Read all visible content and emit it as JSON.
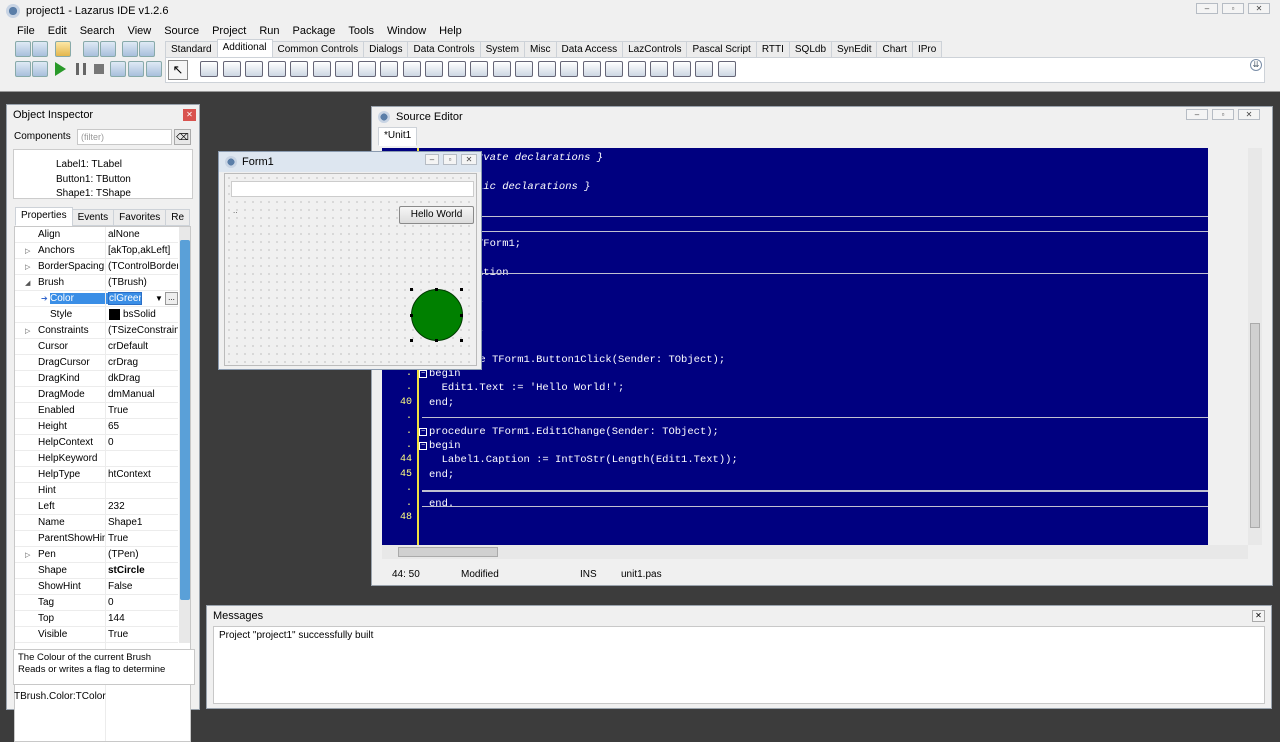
{
  "main": {
    "title": "project1 - Lazarus IDE v1.2.6",
    "menu": [
      "File",
      "Edit",
      "Search",
      "View",
      "Source",
      "Project",
      "Run",
      "Package",
      "Tools",
      "Window",
      "Help"
    ],
    "palette_tabs": [
      "Standard",
      "Additional",
      "Common Controls",
      "Dialogs",
      "Data Controls",
      "System",
      "Misc",
      "Data Access",
      "LazControls",
      "Pascal Script",
      "RTTI",
      "SQLdb",
      "SynEdit",
      "Chart",
      "IPro"
    ],
    "active_tab": "Additional"
  },
  "inspector": {
    "title": "Object Inspector",
    "components_label": "Components",
    "filter_placeholder": "(filter)",
    "tree": [
      "Label1: TLabel",
      "Button1: TButton",
      "Shape1: TShape"
    ],
    "tabs": [
      "Properties",
      "Events",
      "Favorites",
      "Re"
    ],
    "props": [
      {
        "n": "Align",
        "v": "alNone",
        "e": ""
      },
      {
        "n": "Anchors",
        "v": "[akTop,akLeft]",
        "e": "▷"
      },
      {
        "n": "BorderSpacing",
        "v": "(TControlBorder",
        "e": "▷"
      },
      {
        "n": "Brush",
        "v": "(TBrush)",
        "e": "◢"
      },
      {
        "n": "Color",
        "v": "clGreen",
        "e": ""
      },
      {
        "n": "Style",
        "v": "bsSolid",
        "e": ""
      },
      {
        "n": "Constraints",
        "v": "(TSizeConstraint",
        "e": "▷"
      },
      {
        "n": "Cursor",
        "v": "crDefault",
        "e": ""
      },
      {
        "n": "DragCursor",
        "v": "crDrag",
        "e": ""
      },
      {
        "n": "DragKind",
        "v": "dkDrag",
        "e": ""
      },
      {
        "n": "DragMode",
        "v": "dmManual",
        "e": ""
      },
      {
        "n": "Enabled",
        "v": "True",
        "e": ""
      },
      {
        "n": "Height",
        "v": "65",
        "e": ""
      },
      {
        "n": "HelpContext",
        "v": "0",
        "e": ""
      },
      {
        "n": "HelpKeyword",
        "v": "",
        "e": ""
      },
      {
        "n": "HelpType",
        "v": "htContext",
        "e": ""
      },
      {
        "n": "Hint",
        "v": "",
        "e": ""
      },
      {
        "n": "Left",
        "v": "232",
        "e": ""
      },
      {
        "n": "Name",
        "v": "Shape1",
        "e": ""
      },
      {
        "n": "ParentShowHint",
        "v": "True",
        "e": ""
      },
      {
        "n": "Pen",
        "v": "(TPen)",
        "e": "▷"
      },
      {
        "n": "Shape",
        "v": "stCircle",
        "e": ""
      },
      {
        "n": "ShowHint",
        "v": "False",
        "e": ""
      },
      {
        "n": "Tag",
        "v": "0",
        "e": ""
      },
      {
        "n": "Top",
        "v": "144",
        "e": ""
      },
      {
        "n": "Visible",
        "v": "True",
        "e": ""
      }
    ],
    "hint_line1": "The Colour of the current Brush",
    "hint_line2": "Reads or writes a flag to determine",
    "status": "TBrush.Color:TColor"
  },
  "form": {
    "title": "Form1",
    "button_label": "Hello World",
    "shape_color": "#008000"
  },
  "editor": {
    "title": "Source Editor",
    "tab": "*Unit1",
    "lines": [
      {
        "ln": "",
        "t": "rvate declarations }"
      },
      {
        "ln": "",
        "t": ""
      },
      {
        "ln": "",
        "t": "lic declarations }"
      },
      {
        "ln": "",
        "t": ""
      },
      {
        "ln": "",
        "t": ""
      },
      {
        "ln": "",
        "t": ""
      },
      {
        "ln": "",
        "t": "TForm1;"
      },
      {
        "ln": "",
        "t": ""
      },
      {
        "ln": "",
        "t": "ation"
      },
      {
        "ln": "",
        "t": ""
      },
      {
        "ln": "",
        "t": "}"
      },
      {
        "ln": "",
        "t": ""
      },
      {
        "ln": "",
        "t": "}"
      },
      {
        "ln": "",
        "t": ""
      },
      {
        "ln": ".",
        "t": "procedure TForm1.Button1Click(Sender: TObject);"
      },
      {
        "ln": ".",
        "t": "begin"
      },
      {
        "ln": ".",
        "t": "  Edit1.Text := 'Hello World!';"
      },
      {
        "ln": "40",
        "t": "end;"
      },
      {
        "ln": ".",
        "t": ""
      },
      {
        "ln": ".",
        "t": "procedure TForm1.Edit1Change(Sender: TObject);"
      },
      {
        "ln": ".",
        "t": "begin"
      },
      {
        "ln": "44",
        "t": "  Label1.Caption := IntToStr(Length(Edit1.Text));"
      },
      {
        "ln": "45",
        "t": "end;"
      },
      {
        "ln": ".",
        "t": ""
      },
      {
        "ln": ".",
        "t": "end."
      },
      {
        "ln": "48",
        "t": ""
      }
    ],
    "status_pos": "44: 50",
    "status_mod": "Modified",
    "status_ins": "INS",
    "status_file": "unit1.pas",
    "bg": "#000080"
  },
  "messages": {
    "title": "Messages",
    "text": "Project \"project1\" successfully built"
  }
}
